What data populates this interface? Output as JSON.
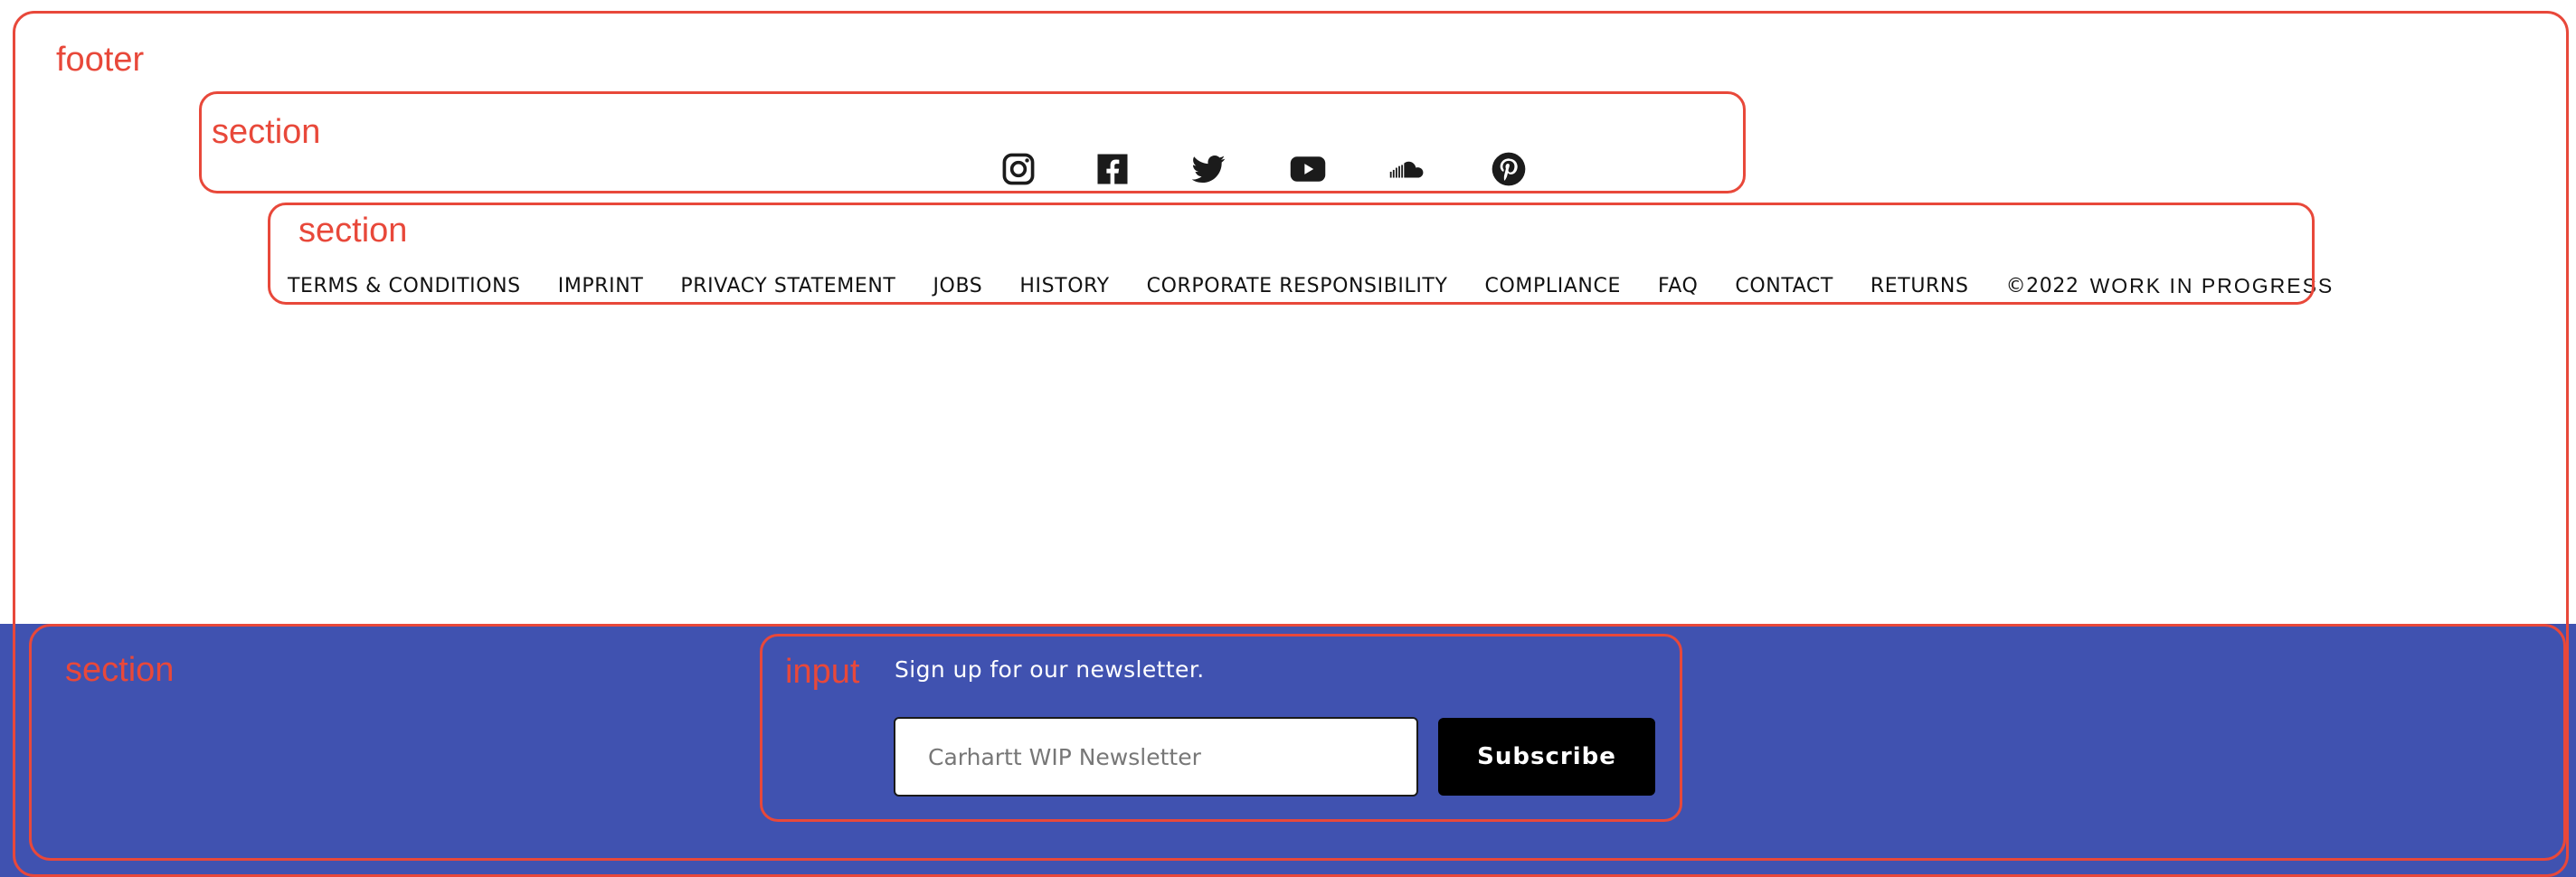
{
  "annotations": {
    "footer": "footer",
    "social_section": "section",
    "links_section": "section",
    "newsletter_section": "section",
    "newsletter_input": "input"
  },
  "social": {
    "icons": [
      "instagram-icon",
      "facebook-icon",
      "twitter-icon",
      "youtube-icon",
      "soundcloud-icon",
      "pinterest-icon"
    ]
  },
  "links": {
    "items": [
      "TERMS & CONDITIONS",
      "IMPRINT",
      "PRIVACY STATEMENT",
      "JOBS",
      "HISTORY",
      "CORPORATE RESPONSIBILITY",
      "COMPLIANCE",
      "FAQ",
      "CONTACT",
      "RETURNS"
    ],
    "copyright": "©2022",
    "brand": "WORK IN PROGRESS"
  },
  "newsletter": {
    "label": "Sign up for our newsletter.",
    "placeholder": "Carhartt WIP Newsletter",
    "button": "Subscribe"
  },
  "colors": {
    "annotation": "#e8483a",
    "newsletter_background": "#4052b0",
    "button_background": "#000000"
  }
}
